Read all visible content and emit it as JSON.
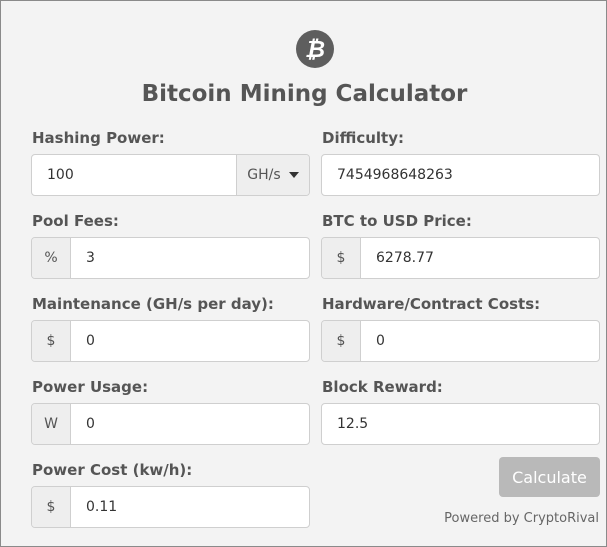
{
  "logo_symbol": "₿",
  "title": "Bitcoin Mining Calculator",
  "hashing_power": {
    "label": "Hashing Power:",
    "value": "100",
    "unit": "GH/s"
  },
  "difficulty": {
    "label": "Difficulty:",
    "value": "7454968648263"
  },
  "pool_fees": {
    "label": "Pool Fees:",
    "prefix": "%",
    "value": "3"
  },
  "btc_usd": {
    "label": "BTC to USD Price:",
    "prefix": "$",
    "value": "6278.77"
  },
  "maintenance": {
    "label": "Maintenance (GH/s per day):",
    "prefix": "$",
    "value": "0"
  },
  "hardware_costs": {
    "label": "Hardware/Contract Costs:",
    "prefix": "$",
    "value": "0"
  },
  "power_usage": {
    "label": "Power Usage:",
    "prefix": "W",
    "value": "0"
  },
  "block_reward": {
    "label": "Block Reward:",
    "value": "12.5"
  },
  "power_cost": {
    "label": "Power Cost (kw/h):",
    "prefix": "$",
    "value": "0.11"
  },
  "calculate_label": "Calculate",
  "powered_by": "Powered by CryptoRival",
  "colors": {
    "accent_gray": "#5e5e5e",
    "button": "#b9b9b9",
    "panel_bg": "#f3f3f3"
  },
  "icons": {
    "logo": "bitcoin-logo-icon",
    "unit_dropdown": "caret-down-icon"
  }
}
